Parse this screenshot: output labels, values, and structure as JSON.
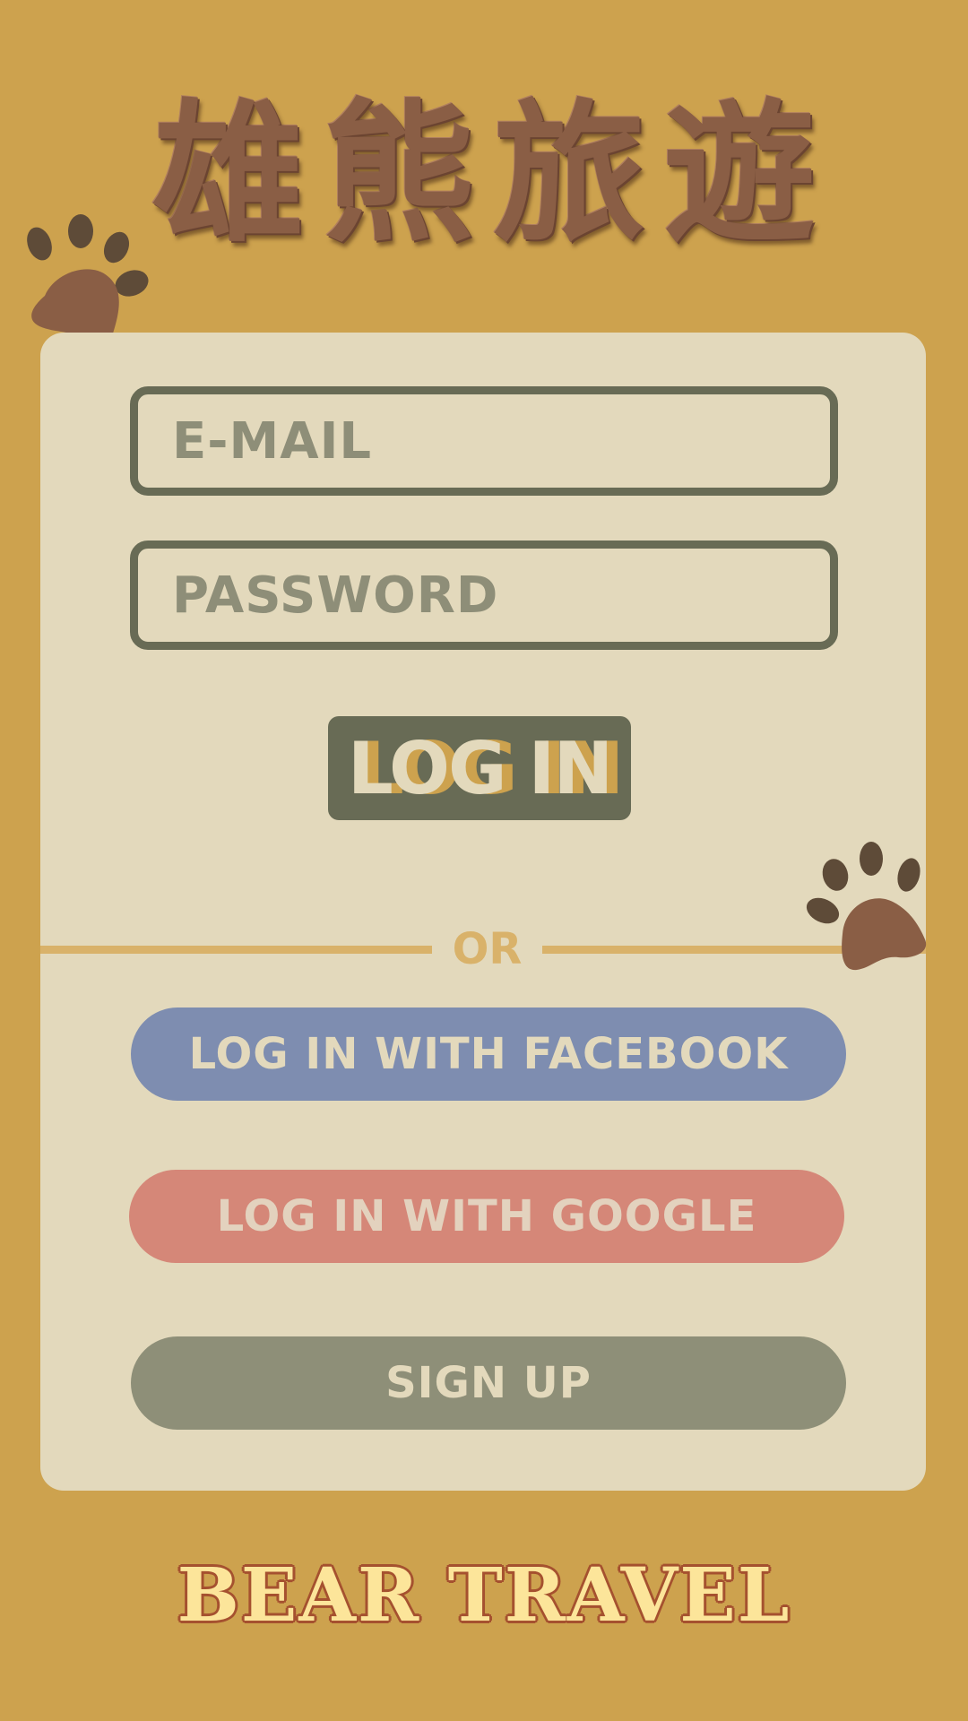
{
  "logo": {
    "chars": [
      "雄",
      "熊",
      "旅",
      "遊"
    ]
  },
  "form": {
    "email_placeholder": "E-MAIL",
    "password_placeholder": "PASSWORD",
    "login_label": "LOG IN"
  },
  "divider": {
    "label": "OR"
  },
  "social": {
    "facebook_label": "LOG IN WITH FACEBOOK",
    "google_label": "LOG IN WITH GOOGLE",
    "signup_label": "SIGN UP"
  },
  "footer": {
    "brand": "BEAR TRAVEL"
  },
  "icons": {
    "paw_top_left": "paw-print-icon",
    "paw_right": "paw-print-icon"
  },
  "colors": {
    "background": "#CDA24E",
    "card": "#E3D9BC",
    "field_border": "#686B55",
    "login_button": "#686B55",
    "divider": "#D9B26A",
    "facebook": "#7E8DB0",
    "google": "#D58778",
    "signup": "#8E8F78",
    "logo": "#8A5E45",
    "brand": "#FCE59A"
  }
}
